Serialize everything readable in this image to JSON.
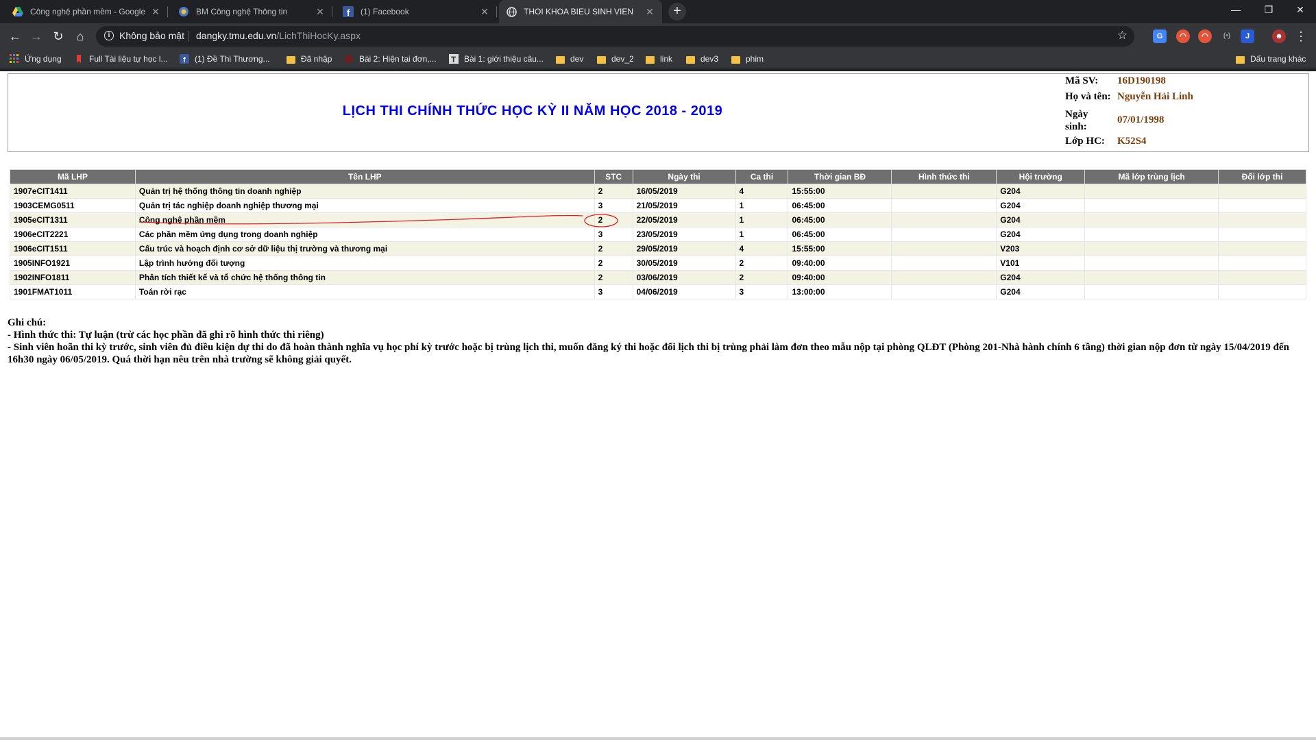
{
  "browser": {
    "tabs": [
      {
        "title": "Công nghệ phần mềm - Google ",
        "icon": "google-drive-icon"
      },
      {
        "title": "BM Công nghệ Thông tin",
        "icon": "site-logo-icon"
      },
      {
        "title": "(1) Facebook",
        "icon": "facebook-icon"
      },
      {
        "title": "THOI KHOA BIEU SINH VIEN",
        "icon": "globe-icon"
      }
    ],
    "address": {
      "security_label": "Không bảo mật",
      "domain": "dangky.tmu.edu.vn",
      "path": "/LichThiHocKy.aspx"
    },
    "bookmarks": [
      {
        "label": "Ứng dụng",
        "icon": "apps-grid-icon"
      },
      {
        "label": "Full Tài liệu tự học l...",
        "icon": "bookmark-red-icon"
      },
      {
        "label": "(1) Đề Thi Thương...",
        "icon": "facebook-icon"
      },
      {
        "label": "Đã nhập",
        "icon": "folder-icon"
      },
      {
        "label": "Bài 2: Hiện tại đơn,...",
        "icon": "site-icon"
      },
      {
        "label": "Bài 1: giới thiệu câu...",
        "icon": "t-letter-icon"
      },
      {
        "label": "dev",
        "icon": "folder-icon"
      },
      {
        "label": "dev_2",
        "icon": "folder-icon"
      },
      {
        "label": "link",
        "icon": "folder-icon"
      },
      {
        "label": "dev3",
        "icon": "folder-icon"
      },
      {
        "label": "phim",
        "icon": "folder-icon"
      }
    ],
    "other_bookmarks": "Dấu trang khác"
  },
  "page": {
    "title": "LỊCH THI CHÍNH THỨC HỌC KỲ II NĂM HỌC 2018 - 2019",
    "student": {
      "id_label": "Mã SV:",
      "id_value": "16D190198",
      "name_label": "Họ và tên:",
      "name_value": "Nguyễn Hải Linh",
      "dob_label": "Ngày sinh:",
      "dob_value": "07/01/1998",
      "class_label": "Lớp HC:",
      "class_value": "K52S4"
    },
    "table": {
      "headers": [
        "Mã LHP",
        "Tên LHP",
        "STC",
        "Ngày thi",
        "Ca thi",
        "Thời gian BĐ",
        "Hình thức thi",
        "Hội trường",
        "Mã lớp trùng lịch",
        "Đổi lớp thi"
      ],
      "rows": [
        [
          "1907eCIT1411",
          "Quản trị hệ thống thông tin doanh nghiệp",
          "2",
          "16/05/2019",
          "4",
          "15:55:00",
          "",
          "G204",
          "",
          ""
        ],
        [
          "1903CEMG0511",
          "Quản trị tác nghiệp doanh nghiệp thương mại",
          "3",
          "21/05/2019",
          "1",
          "06:45:00",
          "",
          "G204",
          "",
          ""
        ],
        [
          "1905eCIT1311",
          "Công nghệ phần mềm",
          "2",
          "22/05/2019",
          "1",
          "06:45:00",
          "",
          "G204",
          "",
          ""
        ],
        [
          "1906eCIT2221",
          "Các phần mềm ứng dụng trong doanh nghiệp",
          "3",
          "23/05/2019",
          "1",
          "06:45:00",
          "",
          "G204",
          "",
          ""
        ],
        [
          "1906eCIT1511",
          "Cấu trúc và hoạch định cơ sở dữ liệu thị trường và thương mại",
          "2",
          "29/05/2019",
          "4",
          "15:55:00",
          "",
          "V203",
          "",
          ""
        ],
        [
          "1905INFO1921",
          "Lập trình hướng đối tượng",
          "2",
          "30/05/2019",
          "2",
          "09:40:00",
          "",
          "V101",
          "",
          ""
        ],
        [
          "1902INFO1811",
          "Phân tích thiết kế và tổ chức hệ thống thông tin",
          "2",
          "03/06/2019",
          "2",
          "09:40:00",
          "",
          "G204",
          "",
          ""
        ],
        [
          "1901FMAT1011",
          "Toán rời rạc",
          "3",
          "04/06/2019",
          "3",
          "13:00:00",
          "",
          "G204",
          "",
          ""
        ]
      ]
    },
    "notes": {
      "heading": "Ghi chú:",
      "line1": " - Hình thức thi: Tự luận (trừ các học phần đã ghi rõ hình thức thi riêng)",
      "line2": " - Sinh viên hoãn thi kỳ trước, sinh viên đủ điều kiện dự thi do đã hoàn thành nghĩa vụ học phí kỳ trước hoặc bị trùng lịch thi, muốn đăng ký thi hoặc đổi lịch thi bị trùng phải làm đơn theo mẫu nộp tại phòng QLĐT (Phòng 201-Nhà hành chính 6 tầng) thời gian nộp đơn từ ngày 15/04/2019 đến 16h30 ngày 06/05/2019. Quá thời hạn nêu trên nhà trường sẽ không giải quyết."
    }
  },
  "colors": {
    "title_blue": "#0000ee",
    "info_value_brown": "#7a3e0a",
    "header_gray": "#6f6f6f",
    "row_alt": "#f3f3e4",
    "annotation_red": "#e02020"
  }
}
